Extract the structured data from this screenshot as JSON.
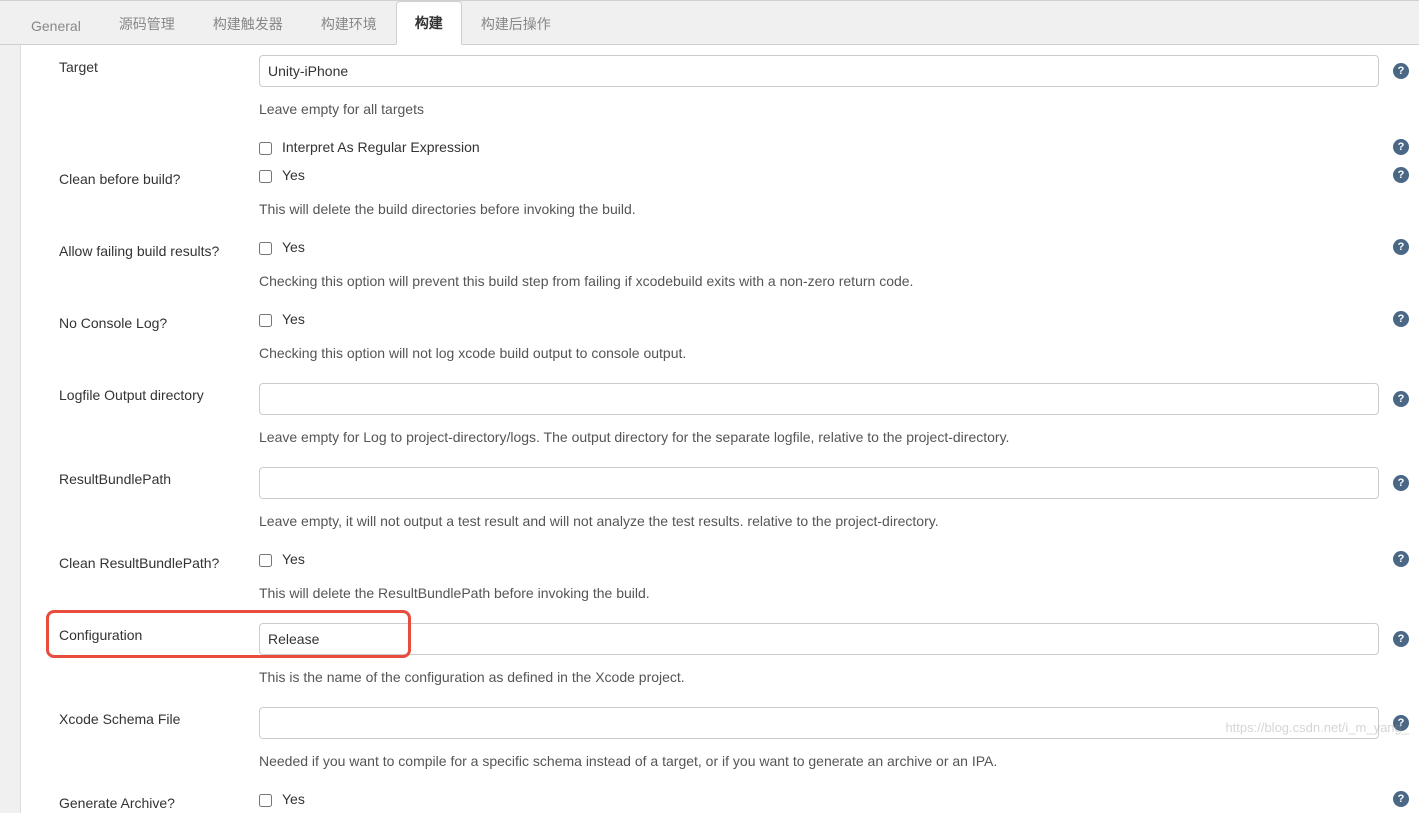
{
  "tabs": [
    {
      "label": "General",
      "active": false
    },
    {
      "label": "源码管理",
      "active": false
    },
    {
      "label": "构建触发器",
      "active": false
    },
    {
      "label": "构建环境",
      "active": false
    },
    {
      "label": "构建",
      "active": true
    },
    {
      "label": "构建后操作",
      "active": false
    }
  ],
  "fields": {
    "target": {
      "label": "Target",
      "value": "Unity-iPhone",
      "description": "Leave empty for all targets"
    },
    "regex": {
      "label": "Interpret As Regular Expression",
      "checked": false
    },
    "cleanBefore": {
      "label": "Clean before build?",
      "checkLabel": "Yes",
      "checked": false,
      "description": "This will delete the build directories before invoking the build."
    },
    "allowFailing": {
      "label": "Allow failing build results?",
      "checkLabel": "Yes",
      "checked": false,
      "description": "Checking this option will prevent this build step from failing if xcodebuild exits with a non-zero return code."
    },
    "noConsole": {
      "label": "No Console Log?",
      "checkLabel": "Yes",
      "checked": false,
      "description": "Checking this option will not log xcode build output to console output."
    },
    "logfile": {
      "label": "Logfile Output directory",
      "value": "",
      "description": "Leave empty for Log to project-directory/logs. The output directory for the separate logfile, relative to the project-directory."
    },
    "resultBundle": {
      "label": "ResultBundlePath",
      "value": "",
      "description": "Leave empty, it will not output a test result and will not analyze the test results. relative to the project-directory."
    },
    "cleanResult": {
      "label": "Clean ResultBundlePath?",
      "checkLabel": "Yes",
      "checked": false,
      "description": "This will delete the ResultBundlePath before invoking the build."
    },
    "configuration": {
      "label": "Configuration",
      "value": "Release",
      "description": "This is the name of the configuration as defined in the Xcode project."
    },
    "schema": {
      "label": "Xcode Schema File",
      "value": "",
      "description": "Needed if you want to compile for a specific schema instead of a target, or if you want to generate an archive or an IPA."
    },
    "archive": {
      "label": "Generate Archive?",
      "checkLabel": "Yes",
      "checked": false
    }
  },
  "watermark": "https://blog.csdn.net/i_m_yang_"
}
